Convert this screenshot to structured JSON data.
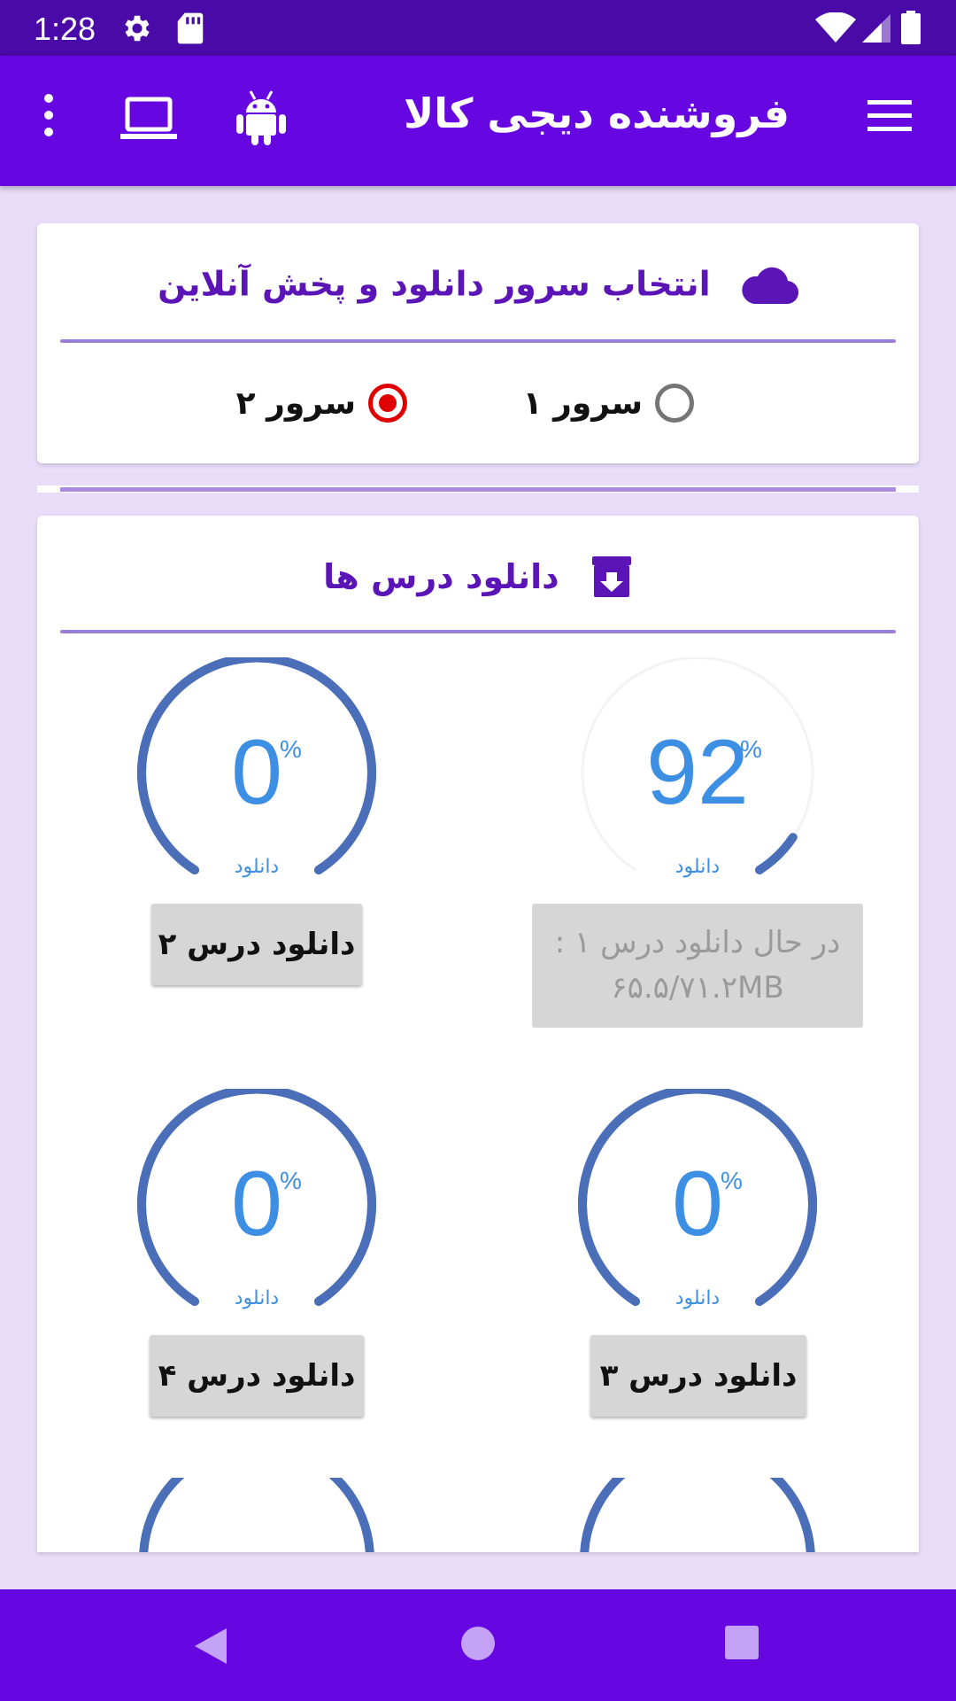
{
  "status_bar": {
    "time": "1:28",
    "icons": [
      "gear-icon",
      "sd-card-icon",
      "wifi-icon",
      "signal-icon",
      "battery-icon"
    ]
  },
  "app_bar": {
    "title": "فروشنده دیجی کالا",
    "actions": [
      "menu-icon",
      "android-icon",
      "laptop-icon",
      "more-vert-icon"
    ]
  },
  "server_card": {
    "title": "انتخاب سرور دانلود و پخش آنلاین",
    "icon": "cloud-icon",
    "options": [
      {
        "label": "سرور ۱",
        "selected": false
      },
      {
        "label": "سرور ۲",
        "selected": true
      }
    ]
  },
  "download_card": {
    "title": "دانلود درس ها",
    "icon": "download-box-icon",
    "lessons": [
      {
        "value": "92",
        "percent": 92,
        "unit": "%",
        "caption": "دانلود",
        "button_line1": "در حال دانلود درس ۱ :",
        "button_line2": "۶۵.۵/۷۱.۲MB",
        "downloading": true
      },
      {
        "value": "0",
        "percent": 0,
        "unit": "%",
        "caption": "دانلود",
        "button": "دانلود درس ۲",
        "downloading": false
      },
      {
        "value": "0",
        "percent": 0,
        "unit": "%",
        "caption": "دانلود",
        "button": "دانلود درس ۳",
        "downloading": false
      },
      {
        "value": "0",
        "percent": 0,
        "unit": "%",
        "caption": "دانلود",
        "button": "دانلود درس ۴",
        "downloading": false
      }
    ]
  },
  "colors": {
    "status_bar": "#4a0aa8",
    "app_bar": "#6606e0",
    "background": "#e8dcf8",
    "accent_text": "#5b14b6",
    "gauge_arc": "#4a6fb8",
    "gauge_text": "#3d8fe3",
    "radio_selected": "#e00000"
  },
  "nav_bar": {
    "buttons": [
      "back-icon",
      "home-icon",
      "recents-icon"
    ]
  }
}
